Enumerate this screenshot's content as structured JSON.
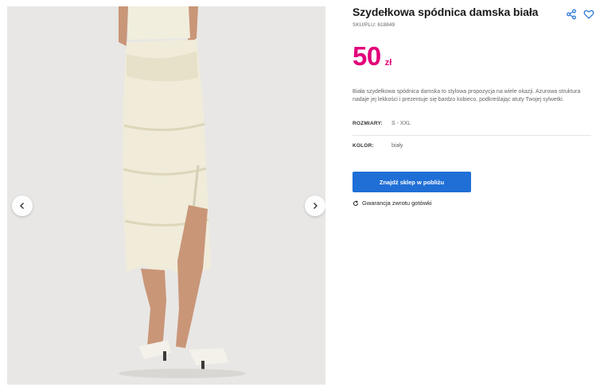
{
  "product": {
    "title": "Szydełkowa spódnica damska biała",
    "sku": "SKU/PLU: 618849",
    "price_value": "50",
    "price_currency": "zł",
    "description": "Biała szydełkowa spódnica damska to stylowa propozycja na wiele okazji. Azurowa struktura nadaje jej lekkości i prezentuje się bardzo kobieco, podkreślając atuty Twojej sylwetki.",
    "attributes": [
      {
        "label": "ROZMIARY:",
        "value": "S - XXL"
      },
      {
        "label": "KOLOR:",
        "value": "biały"
      }
    ],
    "cta_label": "Znajdź sklep w pobliżu",
    "guarantee_label": "Gwarancja zwrotu gotówki"
  },
  "icons": {
    "share": "share-icon",
    "favorite": "heart-icon",
    "gallery_prev": "chevron-left-icon",
    "gallery_next": "chevron-right-icon",
    "guarantee": "refresh-icon"
  },
  "colors": {
    "price": "#e2007a",
    "cta": "#1f6fd6",
    "icon_accent": "#1f6fd6"
  }
}
